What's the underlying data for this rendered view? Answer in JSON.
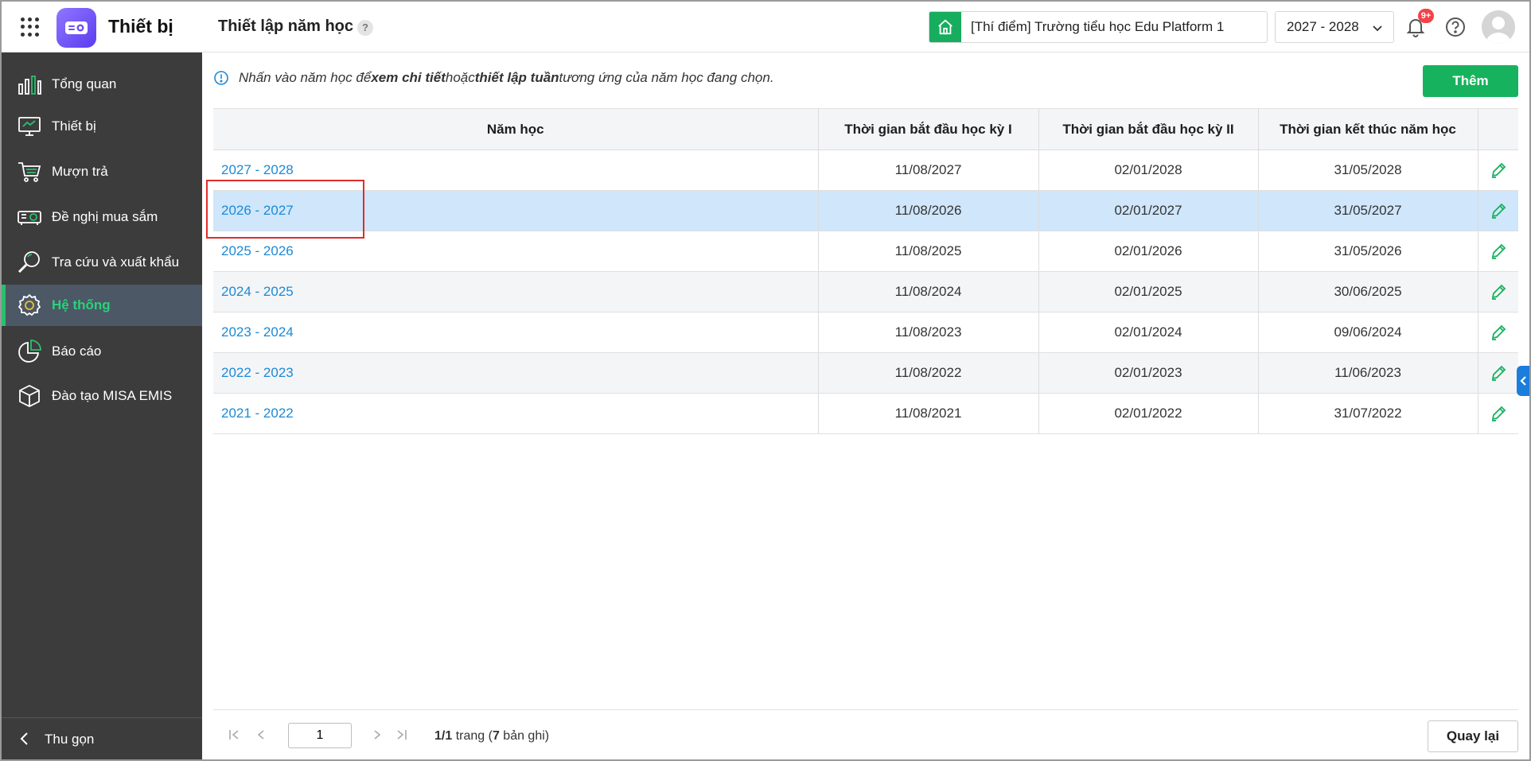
{
  "header": {
    "app_name": "Thiết bị",
    "page_title": "Thiết lập năm học",
    "help_mark": "?",
    "school": "[Thí điểm] Trường tiểu học Edu Platform 1",
    "school_year": "2027 - 2028",
    "notification_badge": "9+"
  },
  "sidebar": {
    "items": [
      {
        "label": "Tổng quan",
        "icon": "chart-bars-icon"
      },
      {
        "label": "Thiết bị",
        "icon": "monitor-icon"
      },
      {
        "label": "Mượn trả",
        "icon": "cart-icon"
      },
      {
        "label": "Đề nghị mua sắm",
        "icon": "projector-icon"
      },
      {
        "label": "Tra cứu và xuất khẩu",
        "icon": "search-icon"
      },
      {
        "label": "Hệ thống",
        "icon": "gear-icon",
        "active": true
      },
      {
        "label": "Báo cáo",
        "icon": "pie-icon"
      },
      {
        "label": "Đào tạo MISA EMIS",
        "icon": "cube-icon"
      }
    ],
    "collapse_label": "Thu gọn"
  },
  "main": {
    "info_prefix": "Nhấn vào năm học để ",
    "info_bold1": "xem chi tiết",
    "info_mid": " hoặc ",
    "info_bold2": "thiết lập tuần",
    "info_suffix": " tương ứng của năm học đang chọn.",
    "add_button": "Thêm",
    "table": {
      "headers": [
        "Năm học",
        "Thời gian bắt đầu học kỳ I",
        "Thời gian bắt đầu học kỳ II",
        "Thời gian kết thúc năm học"
      ],
      "rows": [
        [
          "2027 - 2028",
          "11/08/2027",
          "02/01/2028",
          "31/05/2028"
        ],
        [
          "2026 - 2027",
          "11/08/2026",
          "02/01/2027",
          "31/05/2027"
        ],
        [
          "2025 - 2026",
          "11/08/2025",
          "02/01/2026",
          "31/05/2026"
        ],
        [
          "2024 - 2025",
          "11/08/2024",
          "02/01/2025",
          "30/06/2025"
        ],
        [
          "2023 - 2024",
          "11/08/2023",
          "02/01/2024",
          "09/06/2024"
        ],
        [
          "2022 - 2023",
          "11/08/2022",
          "02/01/2023",
          "11/06/2023"
        ],
        [
          "2021 - 2022",
          "11/08/2021",
          "02/01/2022",
          "31/07/2022"
        ]
      ],
      "selected_row": 1
    },
    "pager": {
      "page_value": "1",
      "page_current": "1/1",
      "page_word": " trang (",
      "record_count": "7",
      "record_word": " bản ghi)"
    },
    "back_button": "Quay lại"
  },
  "colors": {
    "accent_green": "#17b25d",
    "link_blue": "#1b8ad6",
    "selected_row": "#cfe6fb",
    "sidebar_bg": "#3c3c3c",
    "highlight_red": "#e02c2c"
  }
}
